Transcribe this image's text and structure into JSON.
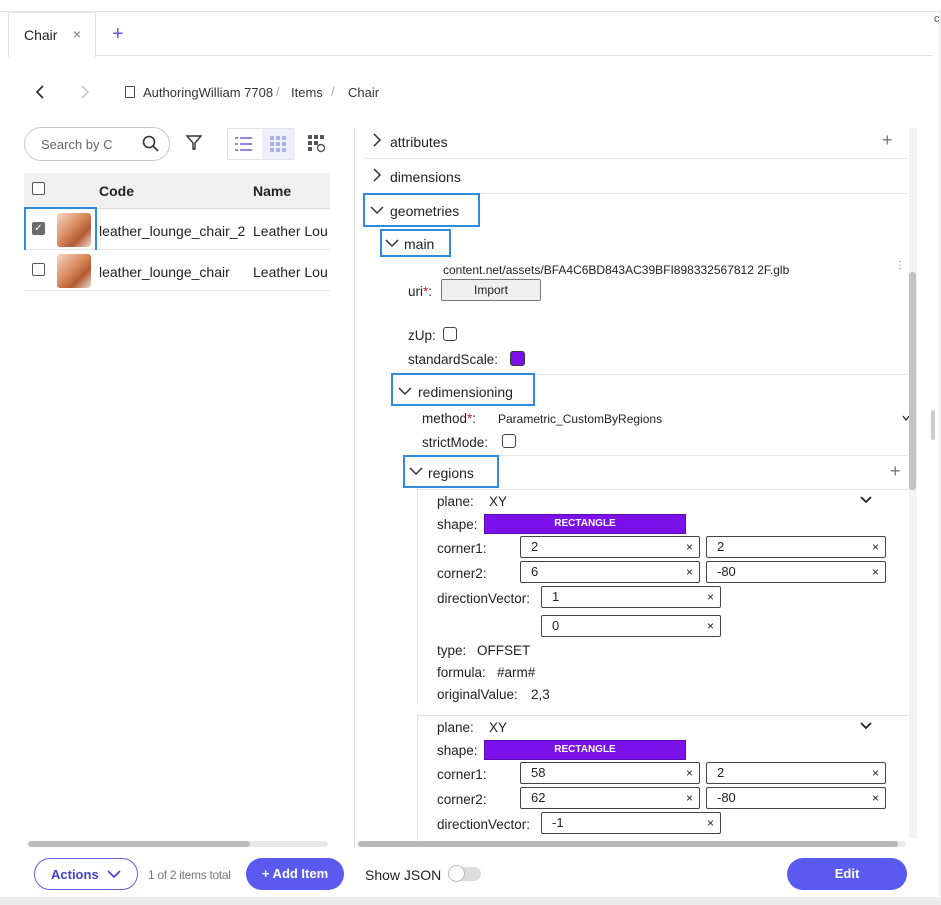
{
  "tab": {
    "label": "Chair",
    "close": "×",
    "add": "+"
  },
  "breadcrumb": {
    "workspace": "AuthoringWilliam 7708",
    "items": "Items",
    "current": "Chair",
    "sep": "/"
  },
  "search": {
    "placeholder": "Search by C"
  },
  "table": {
    "headers": {
      "code": "Code",
      "name": "Name"
    },
    "rows": [
      {
        "code": "leather_lounge_chair_2",
        "name": "Leather Lou",
        "checked": true
      },
      {
        "code": "leather_lounge_chair",
        "name": "Leather Lou",
        "checked": false
      }
    ]
  },
  "footer_left": {
    "actions": "Actions",
    "count": "1 of 2 items total",
    "add": "+ Add Item"
  },
  "footer_right": {
    "show_json": "Show JSON",
    "edit": "Edit"
  },
  "sections": {
    "attributes": "attributes",
    "dimensions": "dimensions",
    "geometries": "geometries",
    "main": "main",
    "redimensioning": "redimensioning",
    "regions": "regions"
  },
  "main": {
    "uri_value": "content.net/assets/BFA4C6BD843AC39BFI898332567812 2F.glb",
    "uri_label": "uri",
    "import": "Import",
    "zup": "zUp:",
    "standard_scale": "standardScale:"
  },
  "redim": {
    "method_label": "method",
    "method_value": "Parametric_CustomByRegions",
    "strict": "strictMode:"
  },
  "regions": [
    {
      "plane_label": "plane:",
      "plane": "XY",
      "shape_label": "shape:",
      "shape": "RECTANGLE",
      "corner1_label": "corner1:",
      "c1a": "2",
      "c1b": "2",
      "corner2_label": "corner2:",
      "c2a": "6",
      "c2b": "-80",
      "dir_label": "directionVector:",
      "dv1": "1",
      "dv2": "0",
      "type_label": "type:",
      "type": "OFFSET",
      "formula_label": "formula:",
      "formula": "#arm#",
      "orig_label": "originalValue:",
      "orig": "2,3"
    },
    {
      "plane_label": "plane:",
      "plane": "XY",
      "shape_label": "shape:",
      "shape": "RECTANGLE",
      "corner1_label": "corner1:",
      "c1a": "58",
      "c1b": "2",
      "corner2_label": "corner2:",
      "c2a": "62",
      "c2b": "-80",
      "dir_label": "directionVector:",
      "dv1": "-1"
    }
  ],
  "colors": {
    "accent": "#5a5af0",
    "shape": "#7b10ea",
    "highlight": "#2f8ae0"
  }
}
